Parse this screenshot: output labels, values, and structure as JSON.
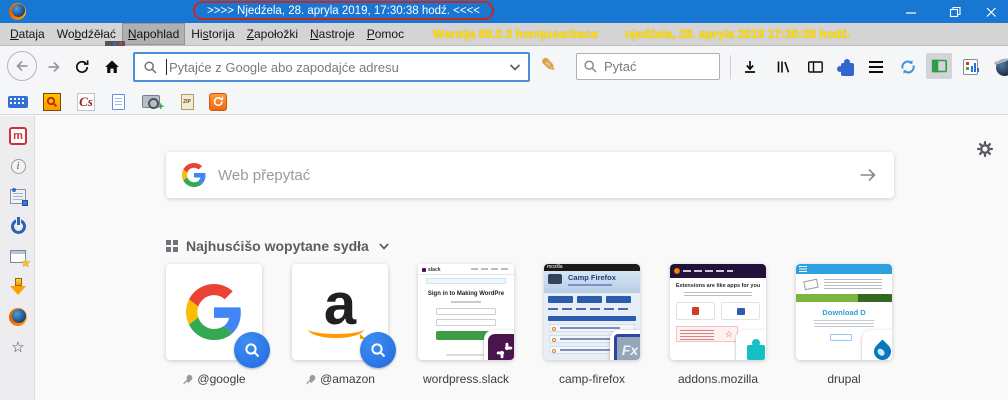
{
  "titlebar": {
    "title": ">>>> Njedźela, 28. apryla 2019, 17:30:38 hodź. <<<<"
  },
  "menubar": {
    "items": [
      {
        "pre": "",
        "key": "D",
        "post": "ataja"
      },
      {
        "pre": "Wo",
        "key": "b",
        "post": "dźěłać"
      },
      {
        "pre": "",
        "key": "N",
        "post": "apohlad"
      },
      {
        "pre": "Hi",
        "key": "s",
        "post": "torija"
      },
      {
        "pre": "",
        "key": "Z",
        "post": "apołožki"
      },
      {
        "pre": "",
        "key": "N",
        "post": "astroje"
      },
      {
        "pre": "",
        "key": "P",
        "post": "omoc"
      }
    ],
    "active_item": "Napohlad",
    "version": "Wersija 66.0.3 hornjoserbsce",
    "clock": "njedźela, 28. apryla 2019  17:30:38 hodź."
  },
  "navbar": {
    "urlbar_placeholder": "Pytajće z Google abo zapodajće adresu",
    "search_placeholder": "Pytać"
  },
  "bookmarks": {
    "zip_label": "ZIP",
    "cs_label": "Cs"
  },
  "sidebar": {
    "m_label": "m",
    "info_label": "i"
  },
  "newtab": {
    "search_placeholder": "Web přepytać",
    "topsites_title": "Najhusćišo wopytane sydła",
    "fx_badge_label": "Fx",
    "tiles": [
      {
        "label": "@google",
        "pinned": true
      },
      {
        "label": "@amazon",
        "pinned": true,
        "logo_letter": "a"
      },
      {
        "label": "wordpress.slack",
        "thumb_brand": "slack",
        "thumb_title": "Sign in to Making WordPre"
      },
      {
        "label": "camp-firefox",
        "thumb_header": "mozilla",
        "thumb_title": "Camp Firefox"
      },
      {
        "label": "addons.mozilla",
        "thumb_title": "Extensions are like apps for you"
      },
      {
        "label": "drupal",
        "thumb_title": "Download D"
      }
    ]
  },
  "colors": {
    "titlebar_blue": "#1777d2",
    "title_highlight_border": "#c8281e",
    "status_text_yellow": "#ffe000",
    "urlbar_focus_blue": "#4a90d9",
    "search_badge_blue": "#2374e1",
    "slack_purple": "#4a154b",
    "addons_teal": "#14c0c6",
    "drupal_blue": "#0678be"
  }
}
